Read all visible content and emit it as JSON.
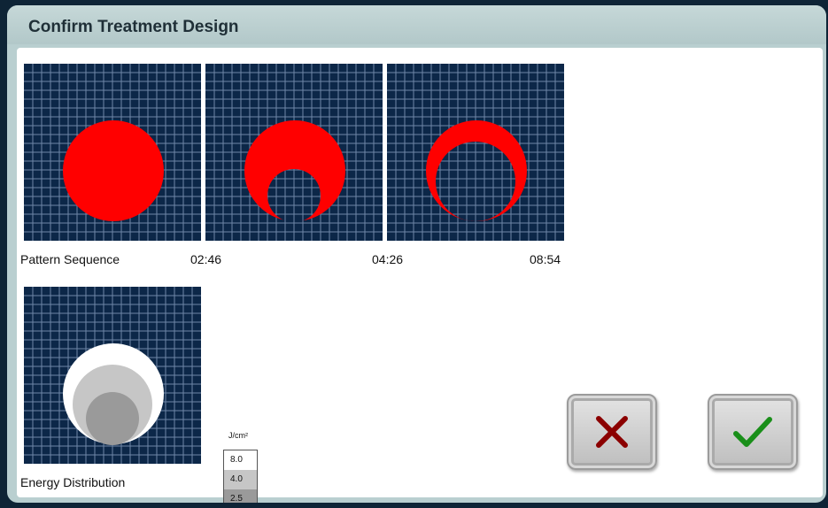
{
  "dialog": {
    "title": "Confirm Treatment Design"
  },
  "pattern_sequence": {
    "label": "Pattern Sequence",
    "times": [
      "02:46",
      "04:26",
      "08:54"
    ]
  },
  "energy_distribution": {
    "label": "Energy Distribution",
    "legend_unit": "J/cm²",
    "levels": [
      {
        "value": "8.0",
        "color": "#ffffff"
      },
      {
        "value": "4.0",
        "color": "#c6c6c6"
      },
      {
        "value": "2.5",
        "color": "#9a9a9a"
      }
    ]
  },
  "colors": {
    "grid_bg": "#0c2748",
    "grid_line": "#6f87a8",
    "pattern": "#ff0000",
    "cancel": "#8b0000",
    "confirm": "#1a8f1a"
  },
  "buttons": {
    "cancel_icon": "x-icon",
    "confirm_icon": "check-icon"
  }
}
